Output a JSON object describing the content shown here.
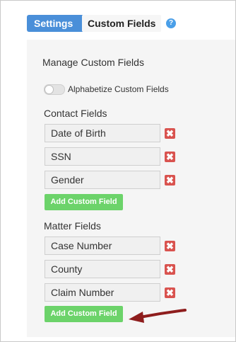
{
  "breadcrumb": {
    "parent": "Settings",
    "current": "Custom Fields",
    "help": "?"
  },
  "heading": "Manage Custom Fields",
  "alphabetize": {
    "label": "Alphabetize Custom Fields",
    "enabled": false
  },
  "contact_section": {
    "title": "Contact Fields",
    "fields": [
      "Date of Birth",
      "SSN",
      "Gender"
    ],
    "add_label": "Add Custom Field"
  },
  "matter_section": {
    "title": "Matter Fields",
    "fields": [
      "Case Number",
      "County",
      "Claim Number"
    ],
    "add_label": "Add Custom Field"
  },
  "delete_glyph": "✖",
  "colors": {
    "accent": "#4a8fd9",
    "add": "#6cd36a",
    "delete": "#d9534f",
    "arrow": "#8e1d1d"
  }
}
